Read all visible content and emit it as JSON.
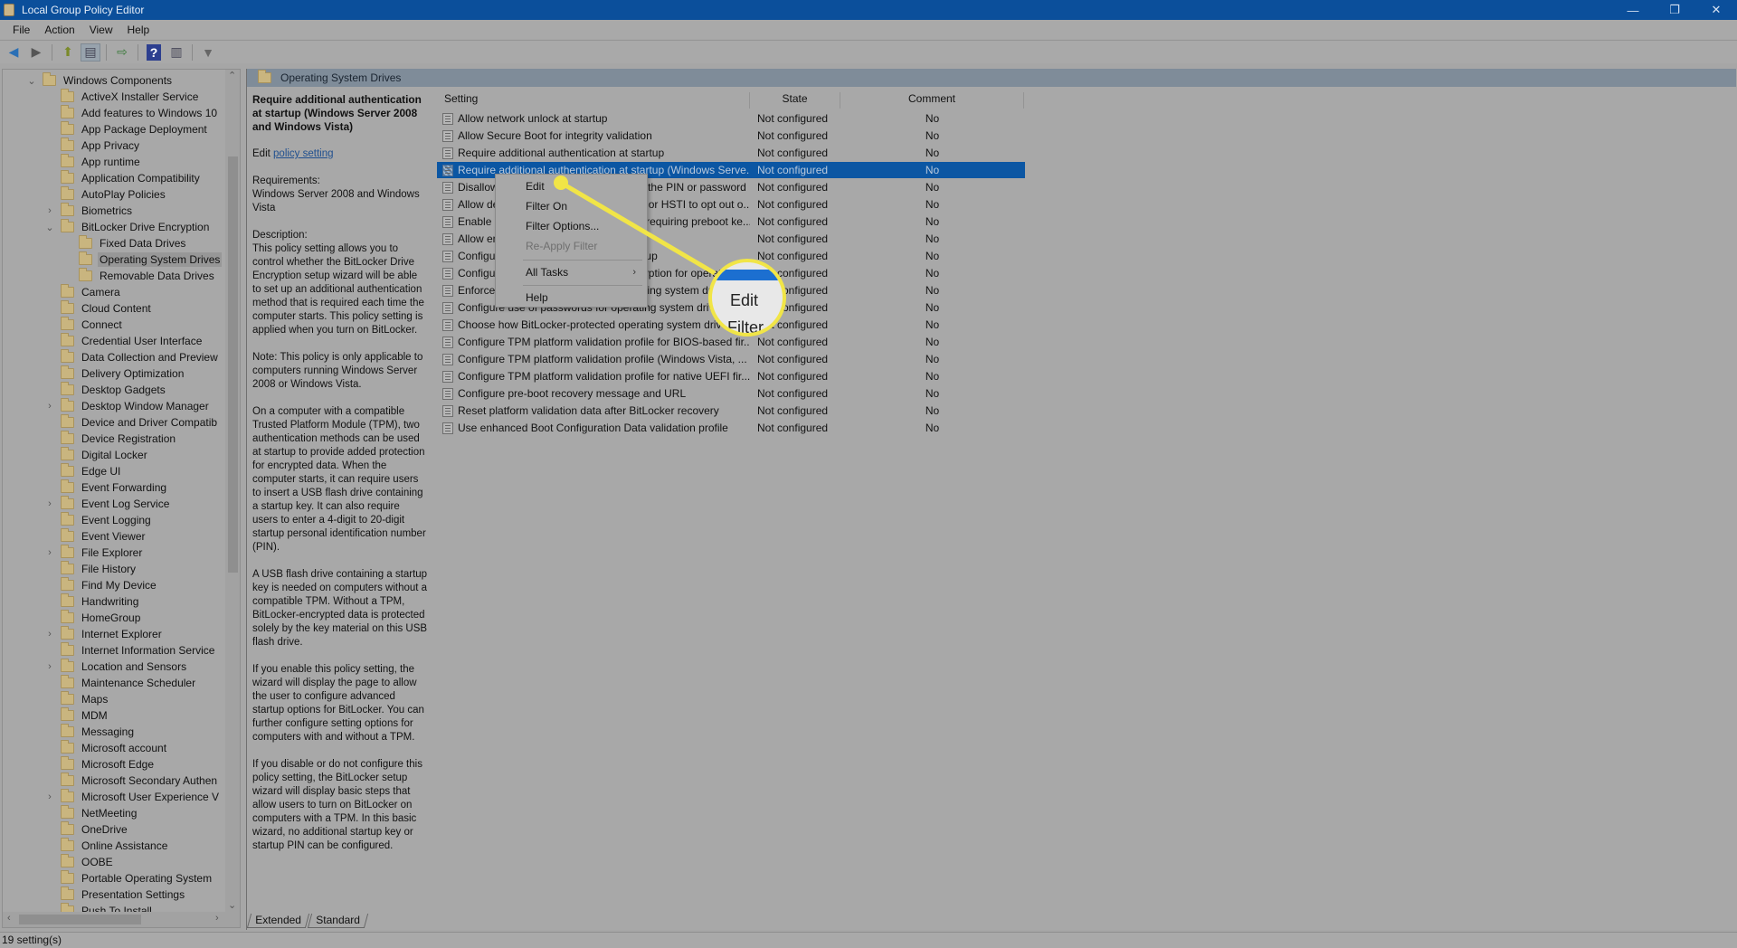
{
  "window": {
    "title": "Local Group Policy Editor",
    "controls": {
      "minimize": "—",
      "restore": "❐",
      "close": "✕"
    }
  },
  "menubar": [
    "File",
    "Action",
    "View",
    "Help"
  ],
  "toolbar": {
    "buttons": [
      {
        "name": "back",
        "icon": "◀"
      },
      {
        "name": "forward",
        "icon": "▶"
      },
      {
        "name": "up-one-level",
        "icon": "⬆"
      },
      {
        "name": "show-hide-console-tree",
        "icon": "▤"
      },
      {
        "name": "export-list",
        "icon": "⇨"
      },
      {
        "name": "help",
        "icon": "?"
      },
      {
        "name": "show-hide-action-pane",
        "icon": "▥"
      },
      {
        "name": "filter",
        "icon": "▼"
      }
    ]
  },
  "tree": {
    "items": [
      {
        "label": "Windows Components",
        "level": 0,
        "expander": "open"
      },
      {
        "label": "ActiveX Installer Service",
        "level": 1,
        "expander": ""
      },
      {
        "label": "Add features to Windows 10",
        "level": 1,
        "expander": ""
      },
      {
        "label": "App Package Deployment",
        "level": 1,
        "expander": ""
      },
      {
        "label": "App Privacy",
        "level": 1,
        "expander": ""
      },
      {
        "label": "App runtime",
        "level": 1,
        "expander": ""
      },
      {
        "label": "Application Compatibility",
        "level": 1,
        "expander": ""
      },
      {
        "label": "AutoPlay Policies",
        "level": 1,
        "expander": ""
      },
      {
        "label": "Biometrics",
        "level": 1,
        "expander": "closed"
      },
      {
        "label": "BitLocker Drive Encryption",
        "level": 1,
        "expander": "open"
      },
      {
        "label": "Fixed Data Drives",
        "level": 2,
        "expander": ""
      },
      {
        "label": "Operating System Drives",
        "level": 2,
        "expander": "",
        "selected": true
      },
      {
        "label": "Removable Data Drives",
        "level": 2,
        "expander": ""
      },
      {
        "label": "Camera",
        "level": 1,
        "expander": ""
      },
      {
        "label": "Cloud Content",
        "level": 1,
        "expander": ""
      },
      {
        "label": "Connect",
        "level": 1,
        "expander": ""
      },
      {
        "label": "Credential User Interface",
        "level": 1,
        "expander": ""
      },
      {
        "label": "Data Collection and Preview",
        "level": 1,
        "expander": ""
      },
      {
        "label": "Delivery Optimization",
        "level": 1,
        "expander": ""
      },
      {
        "label": "Desktop Gadgets",
        "level": 1,
        "expander": ""
      },
      {
        "label": "Desktop Window Manager",
        "level": 1,
        "expander": "closed"
      },
      {
        "label": "Device and Driver Compatib",
        "level": 1,
        "expander": ""
      },
      {
        "label": "Device Registration",
        "level": 1,
        "expander": ""
      },
      {
        "label": "Digital Locker",
        "level": 1,
        "expander": ""
      },
      {
        "label": "Edge UI",
        "level": 1,
        "expander": ""
      },
      {
        "label": "Event Forwarding",
        "level": 1,
        "expander": ""
      },
      {
        "label": "Event Log Service",
        "level": 1,
        "expander": "closed"
      },
      {
        "label": "Event Logging",
        "level": 1,
        "expander": ""
      },
      {
        "label": "Event Viewer",
        "level": 1,
        "expander": ""
      },
      {
        "label": "File Explorer",
        "level": 1,
        "expander": "closed"
      },
      {
        "label": "File History",
        "level": 1,
        "expander": ""
      },
      {
        "label": "Find My Device",
        "level": 1,
        "expander": ""
      },
      {
        "label": "Handwriting",
        "level": 1,
        "expander": ""
      },
      {
        "label": "HomeGroup",
        "level": 1,
        "expander": ""
      },
      {
        "label": "Internet Explorer",
        "level": 1,
        "expander": "closed"
      },
      {
        "label": "Internet Information Service",
        "level": 1,
        "expander": ""
      },
      {
        "label": "Location and Sensors",
        "level": 1,
        "expander": "closed"
      },
      {
        "label": "Maintenance Scheduler",
        "level": 1,
        "expander": ""
      },
      {
        "label": "Maps",
        "level": 1,
        "expander": ""
      },
      {
        "label": "MDM",
        "level": 1,
        "expander": ""
      },
      {
        "label": "Messaging",
        "level": 1,
        "expander": ""
      },
      {
        "label": "Microsoft account",
        "level": 1,
        "expander": ""
      },
      {
        "label": "Microsoft Edge",
        "level": 1,
        "expander": ""
      },
      {
        "label": "Microsoft Secondary Authen",
        "level": 1,
        "expander": ""
      },
      {
        "label": "Microsoft User Experience V",
        "level": 1,
        "expander": "closed"
      },
      {
        "label": "NetMeeting",
        "level": 1,
        "expander": ""
      },
      {
        "label": "OneDrive",
        "level": 1,
        "expander": ""
      },
      {
        "label": "Online Assistance",
        "level": 1,
        "expander": ""
      },
      {
        "label": "OOBE",
        "level": 1,
        "expander": ""
      },
      {
        "label": "Portable Operating System",
        "level": 1,
        "expander": ""
      },
      {
        "label": "Presentation Settings",
        "level": 1,
        "expander": ""
      },
      {
        "label": "Push To Install",
        "level": 1,
        "expander": ""
      }
    ]
  },
  "pane": {
    "header": "Operating System Drives",
    "extended": {
      "title": "Require additional authentication at startup (Windows Server 2008 and Windows Vista)",
      "edit_prefix": "Edit",
      "edit_link": "policy setting",
      "requirements_label": "Requirements:",
      "requirements": "Windows Server 2008 and Windows Vista",
      "description_label": "Description:",
      "paragraphs": [
        "This policy setting allows you to control whether the BitLocker Drive Encryption setup wizard will be able to set up an additional authentication method that is required each time the computer starts. This policy setting is applied when you turn on BitLocker.",
        "Note:  This policy is only applicable to computers running Windows Server 2008 or Windows Vista.",
        "On a computer with a compatible Trusted Platform Module (TPM), two authentication methods can be used at startup to provide added protection for encrypted data. When the computer starts, it can require users to insert a USB flash drive containing a startup key. It can also require users to enter a 4-digit to 20-digit startup personal identification number (PIN).",
        "A USB flash drive containing a startup key is needed on computers without a compatible TPM. Without a TPM, BitLocker-encrypted data is protected solely by the key material on this USB flash drive.",
        "If you enable this policy setting, the wizard will display the page to allow the user to configure advanced startup options for BitLocker. You can further configure setting options for computers with and without a TPM.",
        "If you disable or do not configure this policy setting, the BitLocker setup wizard will display basic steps that allow users to turn on BitLocker on computers with a TPM. In this basic wizard, no additional startup key or startup PIN can be configured."
      ]
    },
    "columns": {
      "setting": "Setting",
      "state": "State",
      "comment": "Comment"
    },
    "rows": [
      {
        "setting": "Allow network unlock at startup",
        "state": "Not configured",
        "comment": "No"
      },
      {
        "setting": "Allow Secure Boot for integrity validation",
        "state": "Not configured",
        "comment": "No"
      },
      {
        "setting": "Require additional authentication at startup",
        "state": "Not configured",
        "comment": "No"
      },
      {
        "setting": "Require additional authentication at startup (Windows Serve...",
        "state": "Not configured",
        "comment": "No",
        "selected": true
      },
      {
        "setting": "Disallow standard users from changing the PIN or password",
        "state": "Not configured",
        "comment": "No"
      },
      {
        "setting": "Allow devices compliant with InstantGo or HSTI to opt out o...",
        "state": "Not configured",
        "comment": "No"
      },
      {
        "setting": "Enable use of BitLocker authentication requiring preboot ke...",
        "state": "Not configured",
        "comment": "No"
      },
      {
        "setting": "Allow enhanced PINs for startup",
        "state": "Not configured",
        "comment": "No"
      },
      {
        "setting": "Configure minimum PIN length for startup",
        "state": "Not configured",
        "comment": "No"
      },
      {
        "setting": "Configure use of hardware-based encryption for operating s...",
        "state": "Not configured",
        "comment": "No"
      },
      {
        "setting": "Enforce drive encryption type on operating system drives",
        "state": "Not configured",
        "comment": "No"
      },
      {
        "setting": "Configure use of passwords for operating system drives",
        "state": "Not configured",
        "comment": "No"
      },
      {
        "setting": "Choose how BitLocker-protected operating system drives can...",
        "state": "Not configured",
        "comment": "No"
      },
      {
        "setting": "Configure TPM platform validation profile for BIOS-based fir...",
        "state": "Not configured",
        "comment": "No"
      },
      {
        "setting": "Configure TPM platform validation profile (Windows Vista, ...",
        "state": "Not configured",
        "comment": "No"
      },
      {
        "setting": "Configure TPM platform validation profile for native UEFI fir...",
        "state": "Not configured",
        "comment": "No"
      },
      {
        "setting": "Configure pre-boot recovery message and URL",
        "state": "Not configured",
        "comment": "No"
      },
      {
        "setting": "Reset platform validation data after BitLocker recovery",
        "state": "Not configured",
        "comment": "No"
      },
      {
        "setting": "Use enhanced Boot Configuration Data validation profile",
        "state": "Not configured",
        "comment": "No"
      }
    ],
    "tabs": [
      "Extended",
      "Standard"
    ]
  },
  "context_menu": {
    "items": [
      {
        "label": "Edit",
        "enabled": true
      },
      {
        "label": "Filter On",
        "enabled": true
      },
      {
        "label": "Filter Options...",
        "enabled": true
      },
      {
        "label": "Re-Apply Filter",
        "enabled": false
      },
      {
        "separator": true
      },
      {
        "label": "All Tasks",
        "enabled": true,
        "submenu": "›"
      },
      {
        "separator": true
      },
      {
        "label": "Help",
        "enabled": true
      }
    ]
  },
  "callout": {
    "magnified_label_1": "Edit",
    "magnified_label_2": "Filter",
    "color": "#f1e547"
  },
  "statusbar": {
    "text": "19 setting(s)"
  }
}
